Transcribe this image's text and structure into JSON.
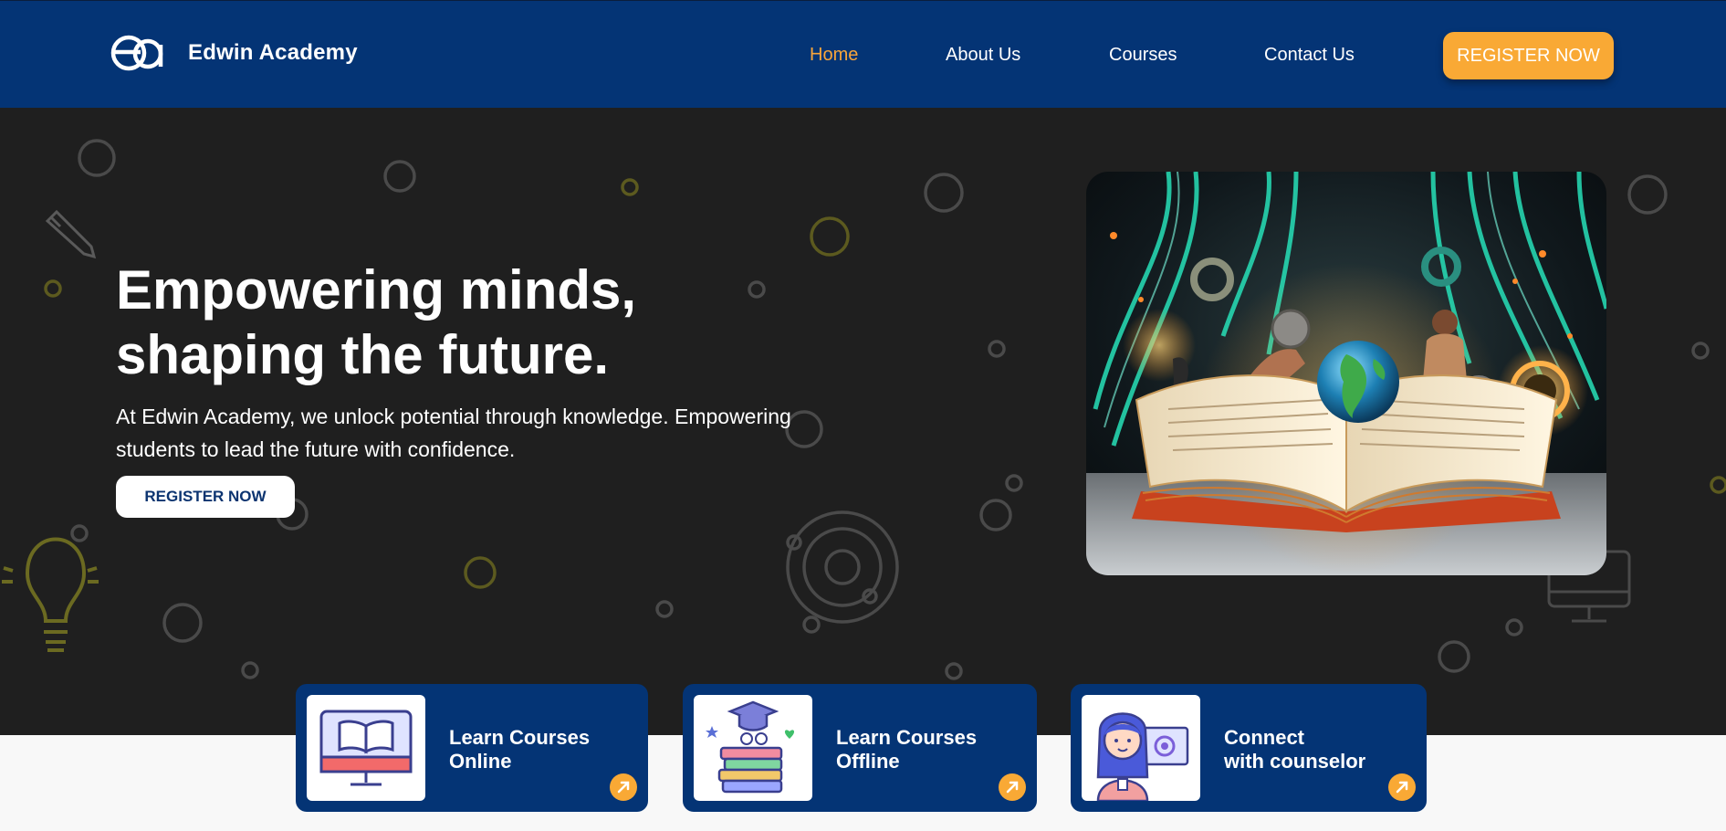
{
  "brand": {
    "name": "Edwin Academy",
    "logo_icon": "ea-monogram-icon"
  },
  "nav": {
    "items": [
      {
        "label": "Home",
        "active": true
      },
      {
        "label": "About Us",
        "active": false
      },
      {
        "label": "Courses",
        "active": false
      },
      {
        "label": "Contact Us",
        "active": false
      }
    ],
    "cta_label": "REGISTER NOW"
  },
  "hero": {
    "title_line1": "Empowering minds,",
    "title_line2": "shaping the future.",
    "subtitle_line1": "At Edwin Academy, we unlock potential through knowledge. Empowering",
    "subtitle_line2": "students to lead the future with confidence.",
    "cta_label": "REGISTER NOW",
    "image_icon": "open-book-globe-illustration"
  },
  "cards": [
    {
      "line1": "Learn Courses",
      "line2": "Online",
      "icon": "monitor-book-icon",
      "arrow_icon": "arrow-up-right-icon"
    },
    {
      "line1": "Learn Courses",
      "line2": "Offline",
      "icon": "books-graduation-cap-icon",
      "arrow_icon": "arrow-up-right-icon"
    },
    {
      "line1": "Connect",
      "line2": "with counselor",
      "icon": "counselor-avatar-icon",
      "arrow_icon": "arrow-up-right-icon"
    }
  ],
  "colors": {
    "navbar_bg": "#043475",
    "accent": "#f9a935",
    "hero_bg": "#1f1f1f",
    "card_bg": "#043475",
    "section_bg": "#f8f8f8"
  }
}
